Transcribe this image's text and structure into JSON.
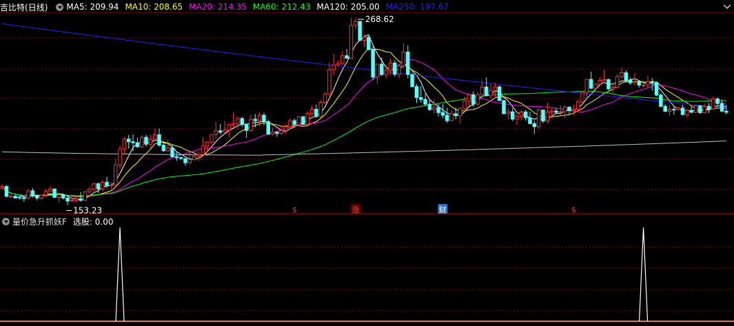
{
  "header": {
    "stock_name": "吉比特",
    "period": "(日线)",
    "ma": [
      {
        "label": "MA5: 209.94",
        "color": "#ffffff"
      },
      {
        "label": "MA10: 208.65",
        "color": "#ffff00"
      },
      {
        "label": "MA20: 214.35",
        "color": "#ff00ff"
      },
      {
        "label": "MA60: 212.43",
        "color": "#00ff00"
      },
      {
        "label": "MA120: 205.00",
        "color": "#ffffff"
      },
      {
        "label": "MA250: 197.67",
        "color": "#2020ff"
      }
    ]
  },
  "indicator": {
    "title": "量价急升抓妖F",
    "value_label": "选股: 0.00"
  },
  "colors": {
    "up": "#ff3232",
    "down": "#54ffff",
    "grid": "#8b0000",
    "ma5": "#ffffff",
    "ma10": "#ffff00",
    "ma20": "#ff00ff",
    "ma60": "#00ff00",
    "ma120": "#c0c0c0",
    "ma250": "#2020ff"
  },
  "chart_data": {
    "type": "candlestick",
    "price_range": [
      150,
      272
    ],
    "max_marker": {
      "label": "268.62",
      "value": 268.62,
      "index": 81
    },
    "min_marker": {
      "label": "153.23",
      "value": 153.23,
      "index": 15
    },
    "event_markers": [
      {
        "label": "$",
        "index": 67,
        "color": "#ff3232"
      },
      {
        "label": "涨",
        "index": 81,
        "color": "#ff3232",
        "boxed": true
      },
      {
        "label": "财",
        "index": 101,
        "color": "#ffffff",
        "boxed": true,
        "box_color": "#3070c0"
      },
      {
        "label": "$",
        "index": 131,
        "color": "#ff3232"
      }
    ],
    "indicator_signal": {
      "spikes": [
        27,
        147
      ],
      "value_range": [
        0,
        1
      ]
    },
    "candles": [
      [
        163.7,
        166.1,
        162.5,
        164.7
      ],
      [
        164.7,
        165.4,
        157.8,
        158.6
      ],
      [
        158.6,
        160.3,
        157.8,
        158.6
      ],
      [
        158.6,
        159.8,
        157.3,
        157.5
      ],
      [
        158.1,
        158.9,
        156.6,
        157.6
      ],
      [
        157.6,
        159.0,
        155.3,
        157.5
      ],
      [
        157.5,
        162.5,
        156.6,
        162.0
      ],
      [
        162.0,
        163.7,
        157.8,
        159.2
      ],
      [
        159.2,
        159.6,
        156.0,
        157.5
      ],
      [
        157.5,
        159.8,
        156.6,
        159.3
      ],
      [
        159.3,
        163.1,
        158.3,
        161.6
      ],
      [
        161.6,
        164.8,
        161.4,
        163.1
      ],
      [
        163.1,
        163.2,
        157.6,
        157.9
      ],
      [
        157.9,
        160.5,
        154.7,
        159.4
      ],
      [
        159.4,
        159.8,
        156.6,
        157.5
      ],
      [
        157.5,
        158.6,
        153.2,
        155.6
      ],
      [
        155.6,
        157.5,
        155.4,
        156.2
      ],
      [
        156.2,
        159.2,
        154.7,
        157.1
      ],
      [
        157.1,
        161.2,
        155.3,
        156.0
      ],
      [
        156.0,
        161.8,
        155.8,
        161.5
      ],
      [
        161.5,
        164.6,
        159.8,
        162.9
      ],
      [
        162.9,
        166.7,
        160.6,
        166.3
      ],
      [
        166.3,
        167.1,
        160.6,
        163.2
      ],
      [
        163.2,
        168.7,
        161.8,
        167.3
      ],
      [
        167.3,
        170.7,
        163.6,
        165.0
      ],
      [
        165.0,
        167.3,
        163.1,
        165.6
      ],
      [
        165.6,
        181.8,
        164.4,
        177.9
      ],
      [
        177.9,
        190.0,
        175.5,
        187.8
      ],
      [
        187.8,
        195.2,
        184.3,
        193.9
      ],
      [
        193.9,
        196.4,
        188.0,
        192.2
      ],
      [
        192.2,
        196.9,
        186.4,
        191.6
      ],
      [
        191.6,
        194.8,
        188.6,
        189.1
      ],
      [
        189.1,
        196.2,
        188.0,
        195.0
      ],
      [
        195.0,
        196.5,
        189.2,
        190.7
      ],
      [
        190.7,
        196.6,
        187.9,
        193.8
      ],
      [
        193.8,
        200.4,
        192.7,
        196.5
      ],
      [
        196.5,
        200.5,
        189.3,
        190.1
      ],
      [
        190.1,
        192.9,
        186.1,
        186.7
      ],
      [
        186.7,
        193.5,
        186.2,
        188.4
      ],
      [
        188.4,
        190.4,
        182.6,
        182.9
      ],
      [
        182.9,
        185.7,
        180.5,
        182.4
      ],
      [
        182.4,
        183.1,
        181.0,
        181.9
      ],
      [
        181.9,
        182.1,
        177.4,
        179.3
      ],
      [
        179.3,
        186.1,
        178.8,
        181.2
      ],
      [
        181.2,
        186.6,
        180.6,
        183.3
      ],
      [
        183.3,
        186.5,
        180.4,
        184.3
      ],
      [
        184.3,
        194.9,
        184.0,
        189.6
      ],
      [
        189.6,
        192.4,
        185.6,
        192.0
      ],
      [
        192.0,
        197.0,
        190.6,
        196.6
      ],
      [
        196.6,
        204.3,
        193.8,
        199.0
      ],
      [
        199.0,
        203.2,
        196.6,
        198.1
      ],
      [
        198.1,
        205.2,
        196.9,
        199.5
      ],
      [
        199.5,
        203.5,
        194.7,
        202.8
      ],
      [
        202.8,
        210.3,
        200.7,
        203.5
      ],
      [
        203.5,
        207.8,
        200.1,
        206.6
      ],
      [
        206.6,
        207.6,
        201.5,
        203.0
      ],
      [
        203.0,
        203.6,
        194.7,
        199.2
      ],
      [
        199.2,
        208.9,
        198.3,
        206.1
      ],
      [
        206.1,
        209.4,
        201.1,
        205.2
      ],
      [
        205.2,
        210.4,
        201.8,
        208.6
      ],
      [
        208.6,
        210.1,
        202.2,
        204.7
      ],
      [
        204.7,
        205.6,
        196.7,
        196.9
      ],
      [
        196.9,
        201.3,
        196.2,
        198.1
      ],
      [
        198.1,
        198.5,
        195.2,
        197.3
      ],
      [
        197.3,
        202.3,
        196.6,
        199.1
      ],
      [
        199.1,
        203.1,
        197.2,
        201.5
      ],
      [
        201.5,
        206.5,
        200.0,
        205.2
      ],
      [
        205.2,
        206.6,
        202.0,
        202.8
      ],
      [
        202.8,
        208.0,
        201.7,
        207.7
      ],
      [
        207.7,
        208.0,
        202.6,
        203.0
      ],
      [
        203.0,
        210.9,
        202.2,
        209.7
      ],
      [
        209.7,
        214.6,
        208.0,
        212.3
      ],
      [
        212.3,
        215.2,
        207.0,
        207.8
      ],
      [
        207.8,
        217.9,
        206.8,
        216.5
      ],
      [
        216.5,
        222.8,
        215.2,
        221.7
      ],
      [
        221.7,
        241.1,
        220.1,
        236.7
      ],
      [
        236.7,
        246.4,
        233.3,
        239.7
      ],
      [
        239.7,
        242.4,
        239.0,
        240.5
      ],
      [
        240.5,
        248.1,
        239.7,
        245.3
      ],
      [
        245.3,
        249.5,
        243.7,
        243.7
      ],
      [
        243.7,
        268.6,
        243.6,
        264.0
      ],
      [
        264.0,
        268.6,
        261.6,
        266.5
      ],
      [
        266.5,
        266.5,
        254.4,
        254.8
      ],
      [
        254.8,
        258.4,
        250.7,
        256.7
      ],
      [
        256.7,
        257.1,
        248.6,
        249.1
      ],
      [
        249.1,
        252.1,
        230.4,
        232.1
      ],
      [
        232.1,
        240.5,
        228.1,
        240.1
      ],
      [
        240.1,
        244.3,
        232.9,
        233.7
      ],
      [
        233.7,
        239.9,
        231.3,
        236.3
      ],
      [
        236.3,
        243.5,
        233.4,
        240.8
      ],
      [
        240.8,
        242.5,
        232.6,
        233.8
      ],
      [
        233.8,
        240.0,
        231.3,
        238.9
      ],
      [
        238.9,
        252.9,
        237.5,
        247.6
      ],
      [
        247.6,
        251.6,
        231.3,
        233.7
      ],
      [
        233.7,
        234.6,
        225.7,
        226.2
      ],
      [
        226.2,
        227.8,
        216.1,
        219.5
      ],
      [
        219.5,
        226.6,
        216.3,
        218.3
      ],
      [
        218.3,
        222.0,
        214.1,
        215.4
      ],
      [
        215.4,
        218.1,
        211.3,
        212.0
      ],
      [
        212.0,
        218.3,
        209.6,
        213.3
      ],
      [
        213.3,
        215.6,
        207.8,
        210.2
      ],
      [
        210.2,
        215.5,
        206.8,
        208.6
      ],
      [
        208.6,
        213.2,
        203.8,
        205.2
      ],
      [
        205.2,
        211.7,
        204.8,
        209.5
      ],
      [
        209.5,
        213.2,
        206.1,
        208.3
      ],
      [
        208.3,
        213.4,
        203.5,
        212.8
      ],
      [
        212.8,
        220.0,
        210.7,
        217.5
      ],
      [
        217.5,
        222.0,
        214.1,
        221.2
      ],
      [
        221.2,
        223.3,
        213.9,
        215.4
      ],
      [
        215.4,
        222.9,
        214.4,
        221.3
      ],
      [
        221.3,
        230.0,
        218.4,
        226.0
      ],
      [
        226.0,
        232.1,
        220.4,
        220.6
      ],
      [
        220.6,
        228.0,
        219.2,
        223.9
      ],
      [
        223.9,
        228.6,
        219.0,
        226.1
      ],
      [
        226.1,
        226.8,
        217.4,
        217.6
      ],
      [
        217.6,
        218.2,
        209.3,
        209.5
      ],
      [
        209.5,
        212.6,
        206.1,
        210.7
      ],
      [
        210.7,
        212.9,
        205.0,
        206.2
      ],
      [
        206.2,
        209.5,
        202.6,
        208.0
      ],
      [
        208.0,
        211.9,
        205.6,
        210.6
      ],
      [
        210.6,
        212.0,
        205.3,
        207.0
      ],
      [
        207.0,
        210.8,
        203.1,
        203.4
      ],
      [
        203.4,
        205.2,
        196.9,
        201.5
      ],
      [
        201.5,
        212.5,
        200.3,
        211.8
      ],
      [
        211.8,
        211.9,
        203.8,
        205.0
      ],
      [
        205.0,
        216.3,
        203.6,
        210.6
      ],
      [
        210.6,
        212.9,
        207.1,
        211.2
      ],
      [
        211.2,
        212.9,
        209.6,
        210.4
      ],
      [
        210.4,
        214.6,
        207.8,
        210.8
      ],
      [
        210.8,
        214.6,
        206.7,
        213.6
      ],
      [
        213.6,
        214.0,
        208.8,
        211.4
      ],
      [
        211.4,
        215.0,
        208.4,
        212.4
      ],
      [
        212.4,
        218.3,
        210.6,
        216.8
      ],
      [
        216.8,
        223.5,
        215.9,
        222.6
      ],
      [
        222.6,
        231.1,
        219.6,
        230.7
      ],
      [
        230.7,
        235.5,
        224.8,
        225.2
      ],
      [
        225.2,
        228.3,
        223.4,
        227.8
      ],
      [
        227.8,
        232.1,
        227.4,
        230.1
      ],
      [
        230.1,
        236.4,
        229.7,
        230.6
      ],
      [
        230.6,
        231.1,
        223.8,
        224.8
      ],
      [
        224.8,
        228.4,
        222.2,
        225.9
      ],
      [
        225.9,
        234.1,
        225.0,
        232.4
      ],
      [
        232.4,
        238.1,
        231.1,
        234.8
      ],
      [
        234.8,
        236.3,
        230.0,
        230.2
      ],
      [
        230.2,
        231.8,
        227.4,
        228.6
      ],
      [
        228.6,
        234.7,
        227.2,
        229.3
      ],
      [
        229.3,
        229.7,
        225.5,
        227.2
      ],
      [
        227.2,
        229.9,
        225.8,
        227.2
      ],
      [
        227.2,
        233.1,
        225.1,
        229.2
      ],
      [
        229.2,
        231.6,
        224.0,
        228.8
      ],
      [
        228.8,
        229.4,
        220.4,
        221.0
      ],
      [
        221.0,
        222.2,
        213.3,
        214.1
      ],
      [
        214.1,
        215.4,
        210.6,
        211.0
      ],
      [
        211.0,
        214.9,
        208.4,
        212.2
      ],
      [
        212.2,
        214.0,
        209.0,
        212.1
      ],
      [
        212.1,
        213.9,
        211.6,
        213.0
      ],
      [
        213.0,
        215.0,
        208.5,
        209.0
      ],
      [
        209.0,
        212.5,
        207.2,
        211.6
      ],
      [
        211.6,
        214.5,
        209.8,
        210.4
      ],
      [
        210.4,
        214.9,
        209.8,
        214.5
      ],
      [
        214.5,
        214.6,
        209.6,
        210.1
      ],
      [
        210.1,
        215.6,
        209.8,
        214.1
      ],
      [
        214.1,
        216.1,
        210.0,
        212.5
      ],
      [
        212.5,
        220.1,
        211.7,
        218.7
      ],
      [
        218.7,
        219.6,
        214.1,
        215.8
      ],
      [
        215.8,
        218.3,
        210.5,
        211.1
      ],
      [
        211.1,
        214.9,
        209.1,
        210.4
      ]
    ]
  }
}
